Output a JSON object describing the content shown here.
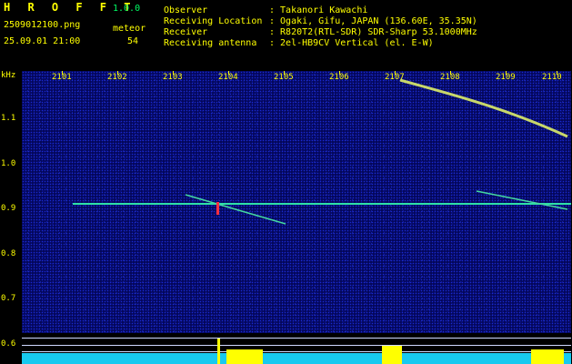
{
  "header": {
    "app_title": "H R O F F T",
    "version": "1.0.0",
    "filename": "2509012100.png",
    "datetime": "25.09.01 21:00",
    "mode_label": "meteor",
    "count": "54",
    "fields": [
      {
        "label": "Observer",
        "value": ": Takanori Kawachi"
      },
      {
        "label": "Receiving Location",
        "value": ": Ogaki, Gifu, JAPAN (136.60E, 35.35N)"
      },
      {
        "label": "Receiver",
        "value": ": R820T2(RTL-SDR) SDR-Sharp 53.1000MHz"
      },
      {
        "label": "Receiving antenna",
        "value": ": 2el-HB9CV Vertical (el. E-W)"
      }
    ]
  },
  "axes": {
    "y_unit": "kHz",
    "y_ticks": [
      "1.1",
      "1.0",
      "0.9",
      "0.8",
      "0.7",
      "0.6"
    ],
    "x_ticks": [
      "2101",
      "2102",
      "2103",
      "2104",
      "2105",
      "2106",
      "2107",
      "2108",
      "2109",
      "2110"
    ]
  },
  "colors": {
    "background": "#04075a",
    "text_yellow": "#ffff00",
    "text_green": "#00ff66",
    "trace": "#20e0a0"
  }
}
